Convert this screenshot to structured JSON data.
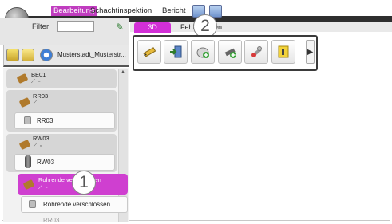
{
  "menu": {
    "tabs": [
      {
        "label": "Bearbeitung",
        "active": true
      },
      {
        "label": "Schachtinspektion",
        "active": false
      },
      {
        "label": "Bericht",
        "active": false
      }
    ],
    "icons": [
      "report-icon",
      "export-icon"
    ]
  },
  "filter": {
    "label": "Filter",
    "value": ""
  },
  "left_toolbar": {
    "project_label": "Musterstadt_Musterstr..."
  },
  "tree": {
    "nodes": [
      {
        "label": "BE01",
        "leaf": ""
      },
      {
        "label": "RR03",
        "leaf": "RR03"
      },
      {
        "label": "RW03",
        "leaf": "RW03"
      },
      {
        "label": "Rohrende verschlossen",
        "leaf": "Rohrende verschlossen",
        "selected": true
      }
    ],
    "overflow_text": "RR03"
  },
  "right_tabs": [
    {
      "label": "3D",
      "active": true
    },
    {
      "label": "Fehlerzeigen",
      "active": false
    }
  ],
  "callouts": [
    "1",
    "2"
  ],
  "colors": {
    "accent": "#c03cbf",
    "selected": "#cf3fd0",
    "dark": "#2e2e2e"
  },
  "toolbar_icons": [
    "pencil-edit-icon",
    "move-inside-icon",
    "manhole-add-icon",
    "pipe-add-icon",
    "connector-icon",
    "info-book-icon"
  ]
}
